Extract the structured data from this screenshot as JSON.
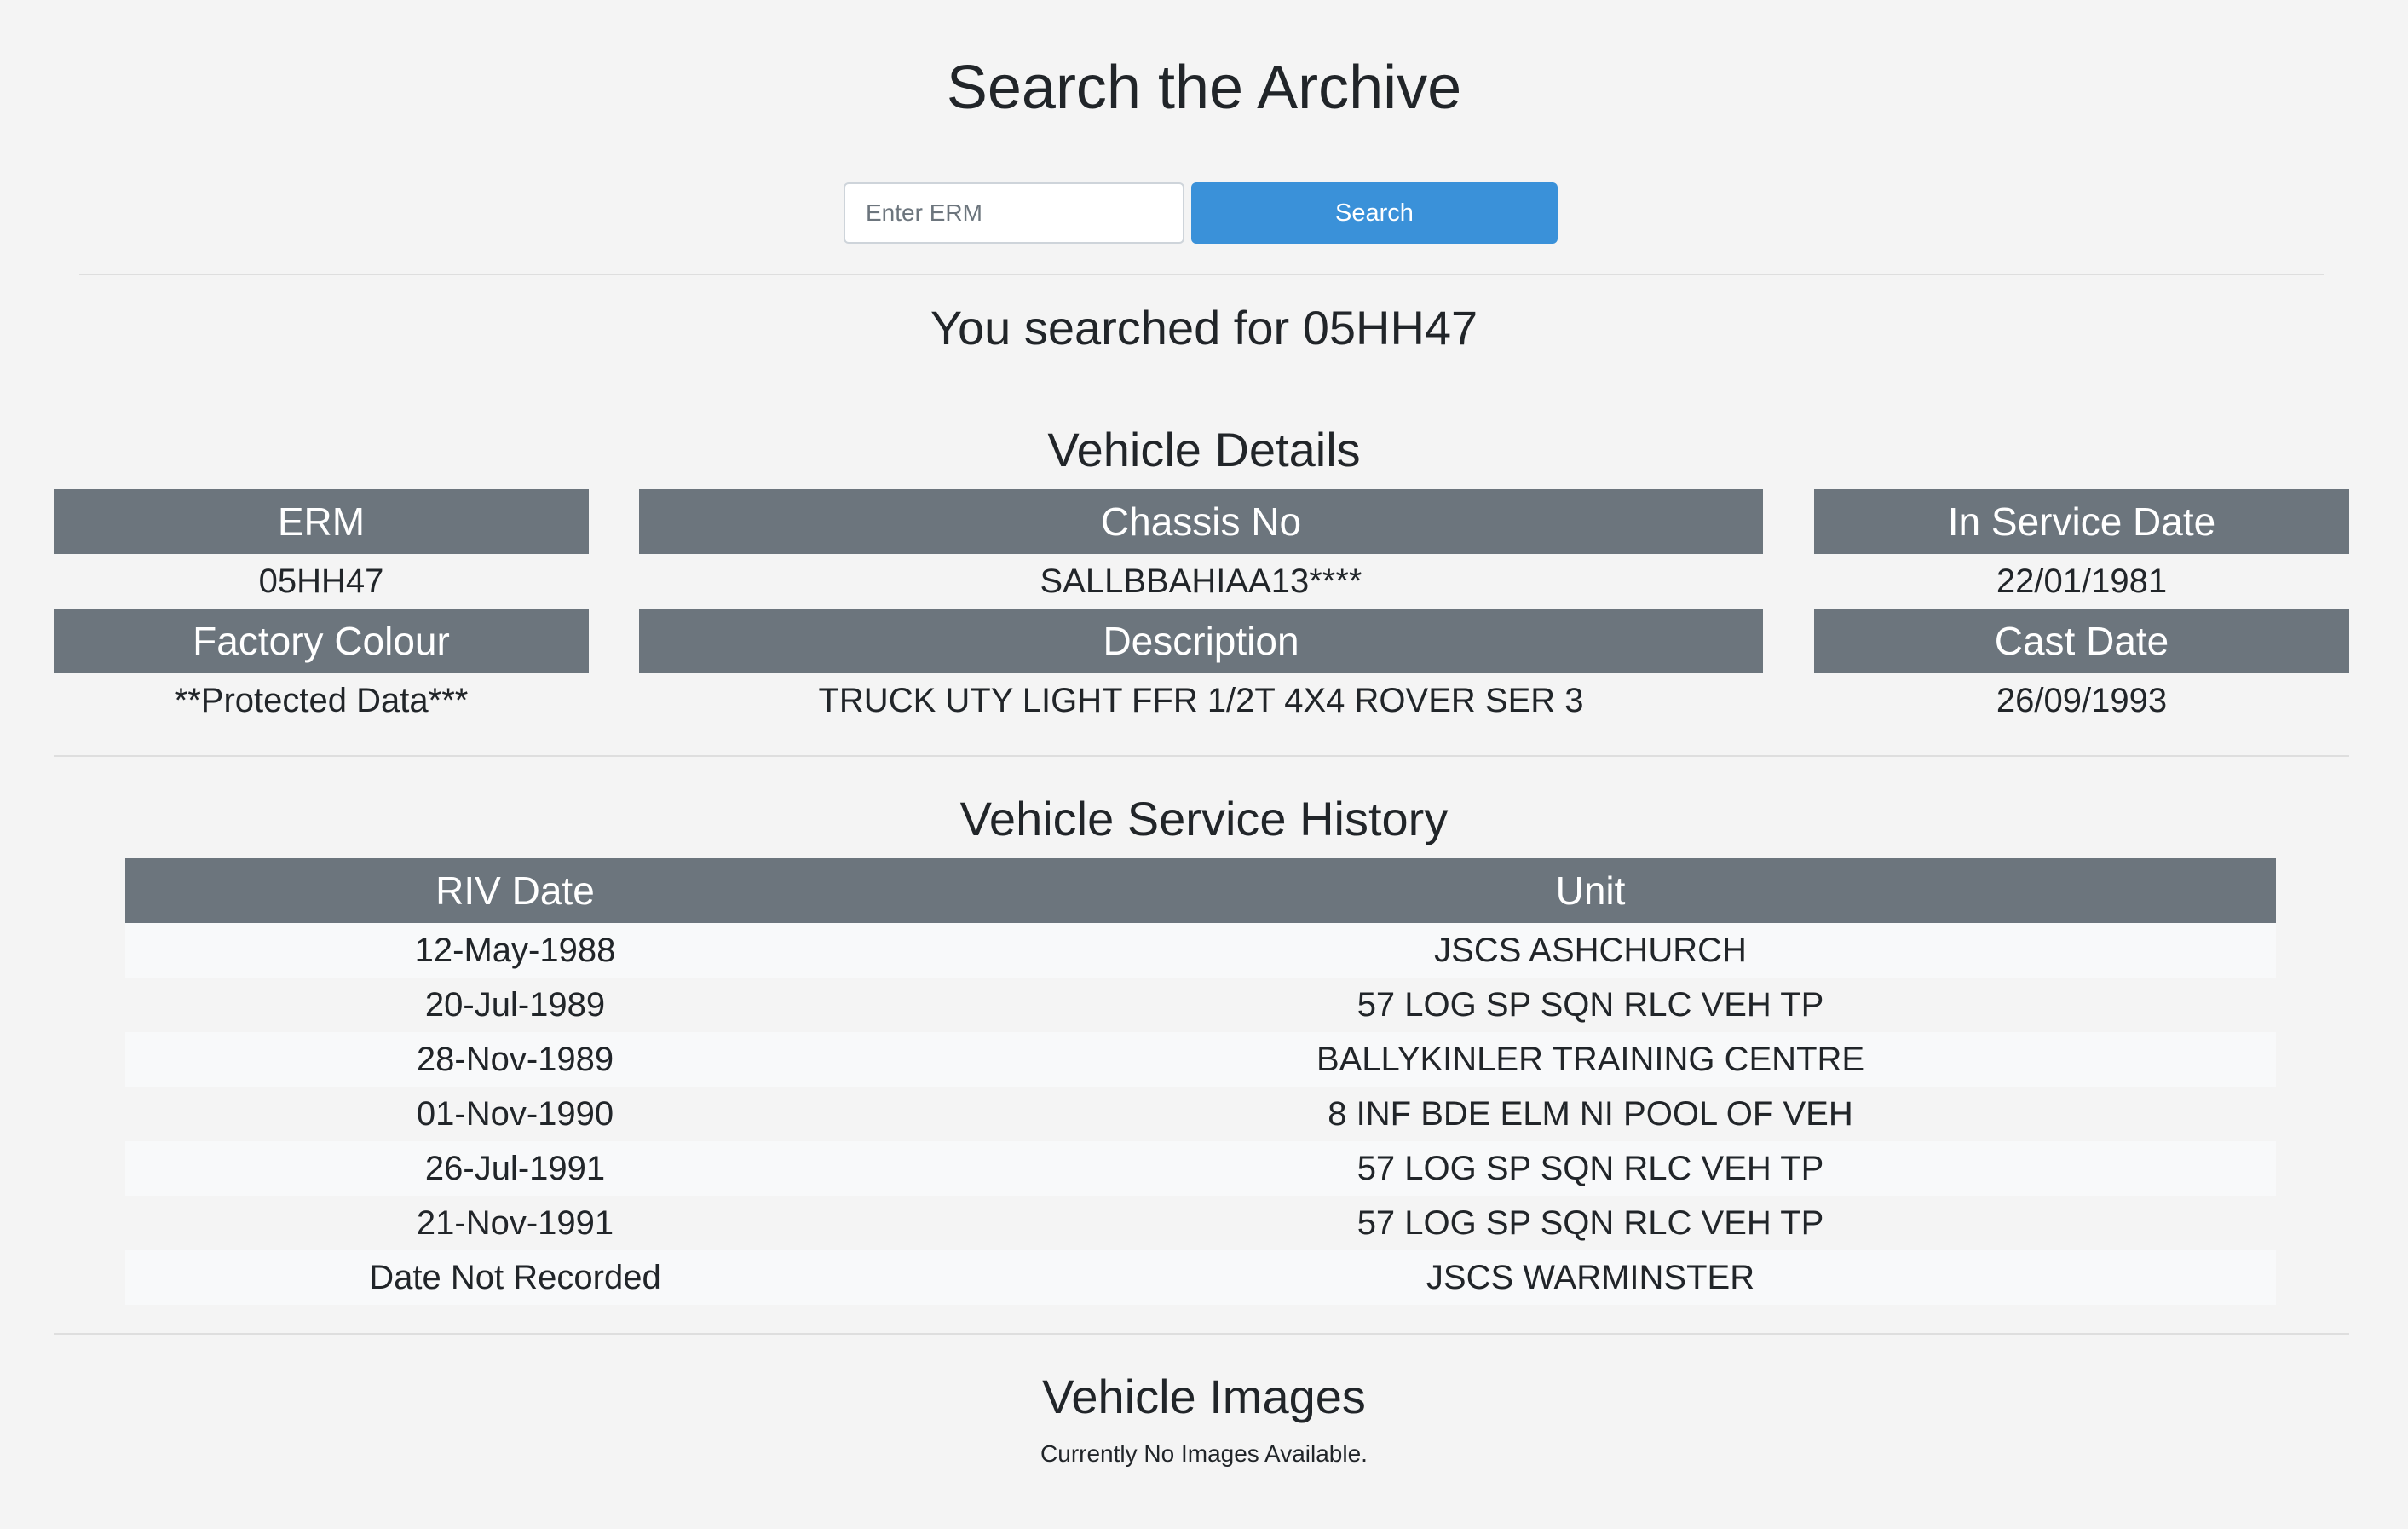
{
  "search": {
    "title": "Search the Archive",
    "placeholder": "Enter ERM",
    "value": "",
    "button_label": "Search"
  },
  "query": {
    "text": "You searched for 05HH47"
  },
  "vehicle_details": {
    "heading": "Vehicle Details",
    "erm": {
      "label": "ERM",
      "value": "05HH47"
    },
    "chassis_no": {
      "label": "Chassis No",
      "value": "SALLBBAHIAA13****"
    },
    "in_service_date": {
      "label": "In Service Date",
      "value": "22/01/1981"
    },
    "factory_colour": {
      "label": "Factory Colour",
      "value": "**Protected Data***"
    },
    "description": {
      "label": "Description",
      "value": "TRUCK UTY LIGHT FFR 1/2T 4X4 ROVER SER 3"
    },
    "cast_date": {
      "label": "Cast Date",
      "value": "26/09/1993"
    }
  },
  "service_history": {
    "heading": "Vehicle Service History",
    "columns": [
      "RIV Date",
      "Unit"
    ],
    "rows": [
      {
        "date": "12-May-1988",
        "unit": "JSCS ASHCHURCH"
      },
      {
        "date": "20-Jul-1989",
        "unit": "57 LOG SP SQN RLC VEH TP"
      },
      {
        "date": "28-Nov-1989",
        "unit": "BALLYKINLER TRAINING CENTRE"
      },
      {
        "date": "01-Nov-1990",
        "unit": "8 INF BDE ELM NI POOL OF VEH"
      },
      {
        "date": "26-Jul-1991",
        "unit": "57 LOG SP SQN RLC VEH TP"
      },
      {
        "date": "21-Nov-1991",
        "unit": "57 LOG SP SQN RLC VEH TP"
      },
      {
        "date": "Date Not Recorded",
        "unit": "JSCS WARMINSTER"
      }
    ]
  },
  "vehicle_images": {
    "heading": "Vehicle Images",
    "note": "Currently No Images Available."
  },
  "colors": {
    "background": "#f4f4f4",
    "header_fill": "#6c757d",
    "primary_button": "#3a91d9"
  }
}
